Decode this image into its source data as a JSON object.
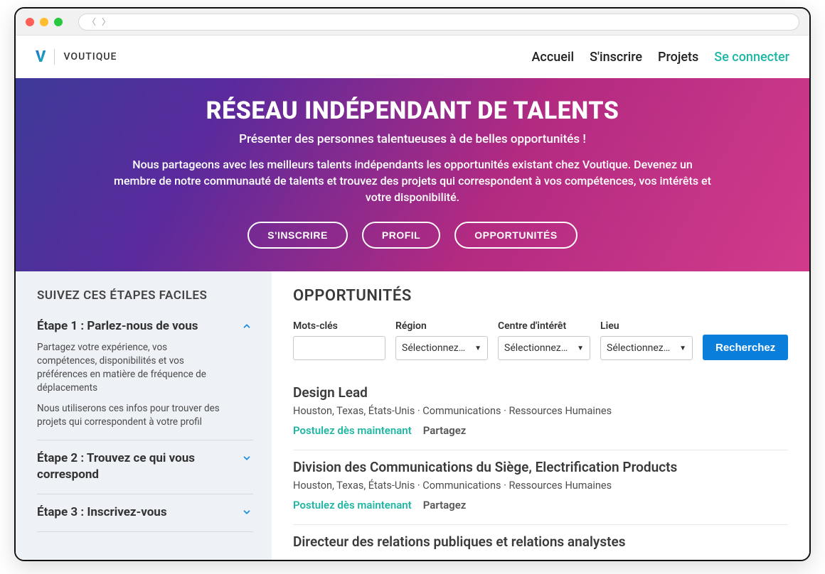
{
  "brand": {
    "mark": "V",
    "name": "VOUTIQUE"
  },
  "nav": {
    "home": "Accueil",
    "signup": "S'inscrire",
    "projects": "Projets",
    "login": "Se connecter"
  },
  "hero": {
    "title": "RÉSEAU INDÉPENDANT DE TALENTS",
    "sub1": "Présenter des personnes talentueuses à de belles opportunités !",
    "sub2": "Nous partageons avec les meilleurs talents indépendants les opportunités existant chez Voutique. Devenez un membre de notre communauté de talents et trouvez des projets qui correspondent à vos compétences, vos intérêts et votre disponibilité.",
    "cta_signup": "S'INSCRIRE",
    "cta_profile": "PROFIL",
    "cta_opps": "OPPORTUNITÉS"
  },
  "sidebar": {
    "heading": "SUIVEZ CES ÉTAPES FACILES",
    "steps": [
      {
        "title": "Étape 1 : Parlez-nous de vous",
        "body1": "Partagez votre expérience, vos compétences, disponibilités et vos préférences en matière de fréquence de déplacements",
        "body2": "Nous utiliserons ces infos pour trouver des projets qui correspondent à votre profil",
        "expanded": true
      },
      {
        "title": "Étape 2 : Trouvez ce qui vous correspond",
        "expanded": false
      },
      {
        "title": "Étape 3 : Inscrivez-vous",
        "expanded": false
      }
    ]
  },
  "main": {
    "heading": "OPPORTUNITÉS",
    "filters": {
      "keywords_label": "Mots-clés",
      "region_label": "Région",
      "interest_label": "Centre d'intérêt",
      "location_label": "Lieu",
      "select_placeholder": "Sélectionnez…",
      "search_btn": "Recherchez"
    },
    "apply_label": "Postulez dès maintenant",
    "share_label": "Partagez",
    "jobs": [
      {
        "title": "Design Lead",
        "meta": "Houston, Texas, États-Unis  ·  Communications  · Ressources Humaines"
      },
      {
        "title": "Division des Communications du Siège, Electrification Products",
        "meta": "Houston, Texas, États-Unis  ·  Communications  · Ressources Humaines"
      },
      {
        "title": "Directeur des relations publiques et relations analystes",
        "meta": ""
      }
    ]
  }
}
